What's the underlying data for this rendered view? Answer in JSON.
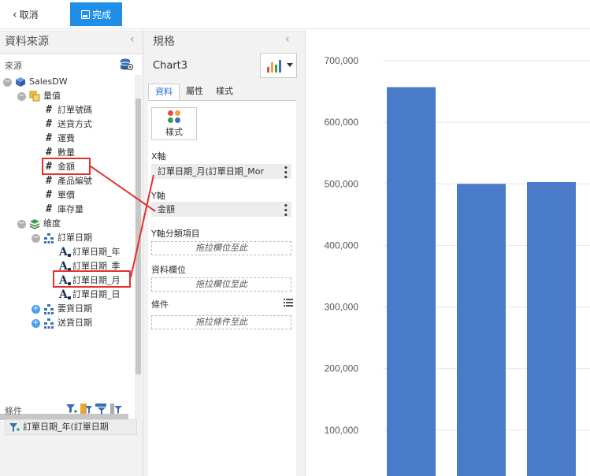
{
  "topbar": {
    "cancel_label": "取消",
    "done_label": "完成"
  },
  "left": {
    "title": "資料來源",
    "source_label": "來源",
    "tree": [
      {
        "label": "SalesDW",
        "level": 0,
        "icon": "db-icon",
        "toggle": "minus"
      },
      {
        "label": "量值",
        "level": 1,
        "icon": "measure-icon",
        "toggle": "minus"
      },
      {
        "label": "訂單號碼",
        "level": 2,
        "icon": "hash"
      },
      {
        "label": "送貨方式",
        "level": 2,
        "icon": "hash"
      },
      {
        "label": "運費",
        "level": 2,
        "icon": "hash"
      },
      {
        "label": "數量",
        "level": 2,
        "icon": "hash"
      },
      {
        "label": "金額",
        "level": 2,
        "icon": "hash"
      },
      {
        "label": "產品編號",
        "level": 2,
        "icon": "hash"
      },
      {
        "label": "單價",
        "level": 2,
        "icon": "hash"
      },
      {
        "label": "庫存量",
        "level": 2,
        "icon": "hash"
      },
      {
        "label": "維度",
        "level": 1,
        "icon": "dimension-icon",
        "toggle": "minus"
      },
      {
        "label": "訂單日期",
        "level": 2,
        "icon": "hierarchy-icon",
        "toggle": "minus"
      },
      {
        "label": "訂單日期_年",
        "level": 3,
        "icon": "attribute-icon"
      },
      {
        "label": "訂單日期_季",
        "level": 3,
        "icon": "attribute-icon"
      },
      {
        "label": "訂單日期_月",
        "level": 3,
        "icon": "attribute-icon"
      },
      {
        "label": "訂單日期_日",
        "level": 3,
        "icon": "attribute-icon"
      },
      {
        "label": "要貨日期",
        "level": 2,
        "icon": "hierarchy-icon",
        "toggle": "plus"
      },
      {
        "label": "送貨日期",
        "level": 2,
        "icon": "hierarchy-icon",
        "toggle": "plus"
      }
    ],
    "condition_label": "條件",
    "condition_item": "訂單日期_年(訂單日期"
  },
  "middle": {
    "title": "規格",
    "chart_name": "Chart3",
    "tabs": [
      "資料",
      "屬性",
      "樣式"
    ],
    "style_button": "樣式",
    "x_axis_label": "X軸",
    "x_axis_field": "訂單日期_月(訂單日期_Mor",
    "y_axis_label": "Y軸",
    "y_axis_field": "金額",
    "y_group_label": "Y軸分類項目",
    "y_group_placeholder": "拖拉欄位至此",
    "data_field_label": "資料欄位",
    "data_field_placeholder": "拖拉欄位至此",
    "condition_label": "條件",
    "condition_placeholder": "拖拉條件至此"
  },
  "colors": {
    "accent": "#1f8fe8",
    "bar": "#4a7bc8",
    "highlight": "#e53030"
  },
  "chart_data": {
    "type": "bar",
    "categories": [
      "",
      "",
      ""
    ],
    "values": [
      657000,
      500000,
      503000
    ],
    "ylim": [
      0,
      700000
    ],
    "yticks": [
      100000,
      200000,
      300000,
      400000,
      500000,
      600000,
      700000
    ],
    "ytick_labels": [
      "100,000",
      "200,000",
      "300,000",
      "400,000",
      "500,000",
      "600,000",
      "700,000"
    ],
    "grid": true,
    "xlabel": "",
    "ylabel": "",
    "title": ""
  }
}
